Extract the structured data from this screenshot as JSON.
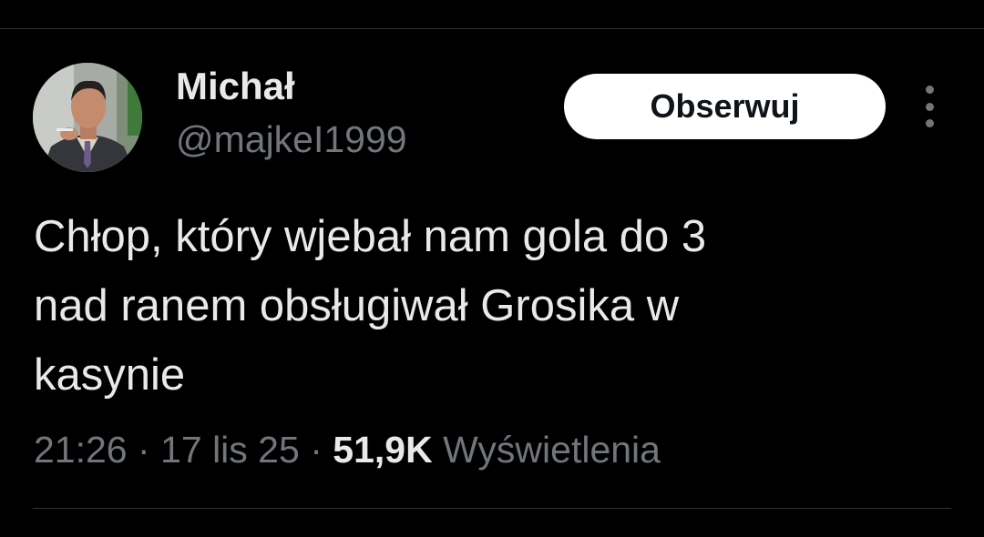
{
  "author": {
    "display_name": "Michał",
    "handle": "@majkeI1999",
    "avatar_icon": "profile-photo"
  },
  "actions": {
    "follow_label": "Obserwuj",
    "more_icon": "more-vertical-icon"
  },
  "tweet": {
    "lines": [
      "Chłop, który wjebał nam gola do 3",
      "nad ranem obsługiwał Grosika w",
      "kasynie"
    ]
  },
  "meta": {
    "time": "21:26",
    "separator": "·",
    "date": "17 lis 25",
    "views_count": "51,9K",
    "views_label": "Wyświetlenia"
  },
  "colors": {
    "background": "#000000",
    "primary_text": "#e7e9ea",
    "secondary_text": "#71767b",
    "divider": "#2f3336",
    "button_bg": "#ffffff",
    "button_text": "#0f1419"
  }
}
